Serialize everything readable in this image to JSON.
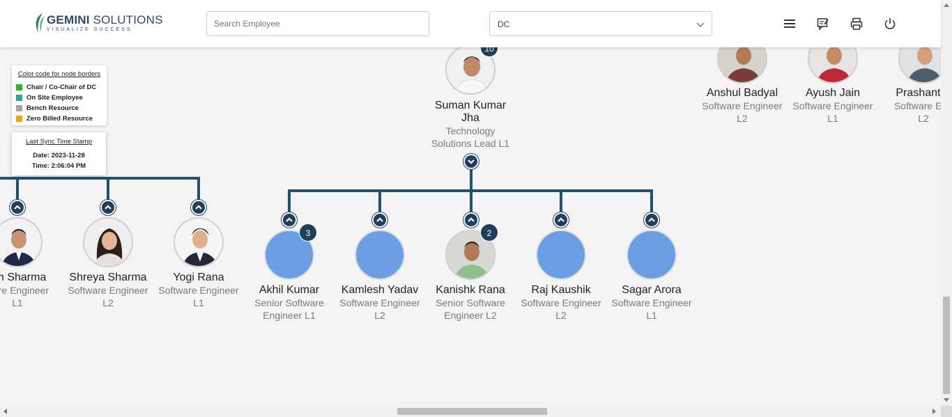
{
  "header": {
    "logo_brand_bold": "GEMINI",
    "logo_brand_rest": " SOLUTIONS",
    "logo_tagline": "VISUALIZE SUCCESS",
    "search_placeholder": "Search Employee",
    "dc_select_value": "DC",
    "buttons": [
      "menu-icon",
      "feedback-icon",
      "print-icon",
      "power-icon"
    ]
  },
  "legend": {
    "title": "Color code for node borders",
    "items": [
      {
        "label": "Chair / Co-Chair of DC",
        "color": "#2db52d"
      },
      {
        "label": "On Site Employee",
        "color": "#2aa3a3"
      },
      {
        "label": "Bench Resource",
        "color": "#a6a6a6"
      },
      {
        "label": "Zero Billed Resource",
        "color": "#f5a100"
      }
    ]
  },
  "sync": {
    "title": "Last Sync Time Stamp",
    "date": "Date: 2023-11-28",
    "time": "Time: 2:06:04 PM"
  },
  "manager": {
    "name_line1": "Suman Kumar",
    "name_line2": "Jha",
    "role_line1": "Technology",
    "role_line2": "Solutions Lead L1",
    "badge": "10"
  },
  "left_nodes": [
    {
      "name": "am Sharma",
      "role_line1": "ware Engineer",
      "role_line2": "L1"
    },
    {
      "name": "Shreya Sharma",
      "role_line1": "Software Engineer",
      "role_line2": "L2"
    },
    {
      "name": "Yogi Rana",
      "role_line1": "Software Engineer",
      "role_line2": "L1"
    }
  ],
  "reports": [
    {
      "name": "Akhil Kumar",
      "role_line1": "Senior Software",
      "role_line2": "Engineer L1",
      "badge": "3"
    },
    {
      "name": "Kamlesh Yadav",
      "role_line1": "Software Engineer",
      "role_line2": "L2",
      "badge": ""
    },
    {
      "name": "Kanishk Rana",
      "role_line1": "Senior Software",
      "role_line2": "Engineer L2",
      "badge": "2"
    },
    {
      "name": "Raj Kaushik",
      "role_line1": "Software Engineer",
      "role_line2": "L2",
      "badge": ""
    },
    {
      "name": "Sagar Arora",
      "role_line1": "Software Engineer",
      "role_line2": "L1",
      "badge": ""
    }
  ],
  "top_right_nodes": [
    {
      "name": "Anshul Badyal",
      "role_line1": "Software Engineer",
      "role_line2": "L2"
    },
    {
      "name": "Ayush Jain",
      "role_line1": "Software Engineer",
      "role_line2": "L1"
    },
    {
      "name": "Prashant S",
      "role_line1": "Software Eng",
      "role_line2": "L2"
    }
  ]
}
